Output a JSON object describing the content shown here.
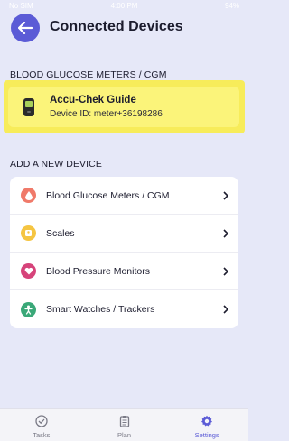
{
  "status_bar": {
    "carrier": "No SIM",
    "time": "4:00 PM",
    "battery": "94%"
  },
  "header": {
    "title": "Connected Devices"
  },
  "connected_section": {
    "title": "BLOOD GLUCOSE METERS / CGM"
  },
  "connected_device": {
    "name": "Accu-Chek Guide",
    "device_id": "Device ID: meter+36198286"
  },
  "add_section": {
    "title": "ADD A NEW DEVICE"
  },
  "device_types": [
    {
      "label": "Blood Glucose Meters / CGM",
      "icon": "blood-drop-icon",
      "color": "#f07a6a"
    },
    {
      "label": "Scales",
      "icon": "scale-icon",
      "color": "#f5c542"
    },
    {
      "label": "Blood Pressure Monitors",
      "icon": "heart-icon",
      "color": "#d6437a"
    },
    {
      "label": "Smart Watches / Trackers",
      "icon": "person-icon",
      "color": "#3aa878"
    }
  ],
  "tabs": [
    {
      "label": "Tasks",
      "icon": "check-circle-icon",
      "active": false
    },
    {
      "label": "Plan",
      "icon": "clipboard-icon",
      "active": false
    },
    {
      "label": "Settings",
      "icon": "gear-icon",
      "active": true
    }
  ],
  "colors": {
    "accent": "#5b5bd6",
    "background": "#e6e8f8",
    "highlight": "#f7ec5a"
  }
}
